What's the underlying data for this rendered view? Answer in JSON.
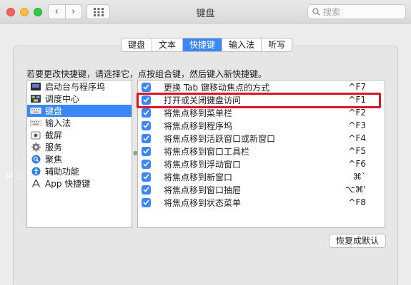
{
  "window": {
    "title": "键盘"
  },
  "toolbar": {
    "back_glyph": "‹",
    "forward_glyph": "›",
    "search_placeholder": "搜索"
  },
  "tabs": [
    {
      "label": "键盘",
      "active": false
    },
    {
      "label": "文本",
      "active": false
    },
    {
      "label": "快捷键",
      "active": true
    },
    {
      "label": "输入法",
      "active": false
    },
    {
      "label": "听写",
      "active": false
    }
  ],
  "instruction": "若要更改快捷键，请选择它，点按组合键，然后键入新快捷键。",
  "categories": [
    {
      "label": "启动台与程序坞",
      "icon": "launchpad-icon",
      "selected": false
    },
    {
      "label": "调度中心",
      "icon": "mission-control-icon",
      "selected": false
    },
    {
      "label": "键盘",
      "icon": "keyboard-icon",
      "selected": true
    },
    {
      "label": "输入法",
      "icon": "input-source-icon",
      "selected": false
    },
    {
      "label": "截屏",
      "icon": "screenshot-icon",
      "selected": false
    },
    {
      "label": "服务",
      "icon": "gear-icon",
      "selected": false
    },
    {
      "label": "聚焦",
      "icon": "spotlight-icon",
      "selected": false
    },
    {
      "label": "辅助功能",
      "icon": "accessibility-icon",
      "selected": false
    },
    {
      "label": "App 快捷键",
      "icon": "app-store-icon",
      "selected": false
    }
  ],
  "shortcuts": [
    {
      "label": "更换 Tab 键移动焦点的方式",
      "key": "^F7",
      "checked": true
    },
    {
      "label": "打开或关闭键盘访问",
      "key": "^F1",
      "checked": true
    },
    {
      "label": "将焦点移到菜单栏",
      "key": "^F2",
      "checked": true
    },
    {
      "label": "将焦点移到程序坞",
      "key": "^F3",
      "checked": true
    },
    {
      "label": "将焦点移到活跃窗口或新窗口",
      "key": "^F4",
      "checked": true
    },
    {
      "label": "将焦点移到窗口工具栏",
      "key": "^F5",
      "checked": true
    },
    {
      "label": "将焦点移到浮动窗口",
      "key": "^F6",
      "checked": true
    },
    {
      "label": "将焦点移到新窗口",
      "key": "⌘`",
      "checked": true
    },
    {
      "label": "将焦点移到窗口抽屉",
      "key": "⌥⌘'",
      "checked": true
    },
    {
      "label": "将焦点移到状态菜单",
      "key": "^F8",
      "checked": true
    }
  ],
  "restore_button": "恢复成默认",
  "watermark": "M ○ ... m",
  "colors": {
    "accent": "#3b87f7",
    "highlight": "#d8152a"
  }
}
